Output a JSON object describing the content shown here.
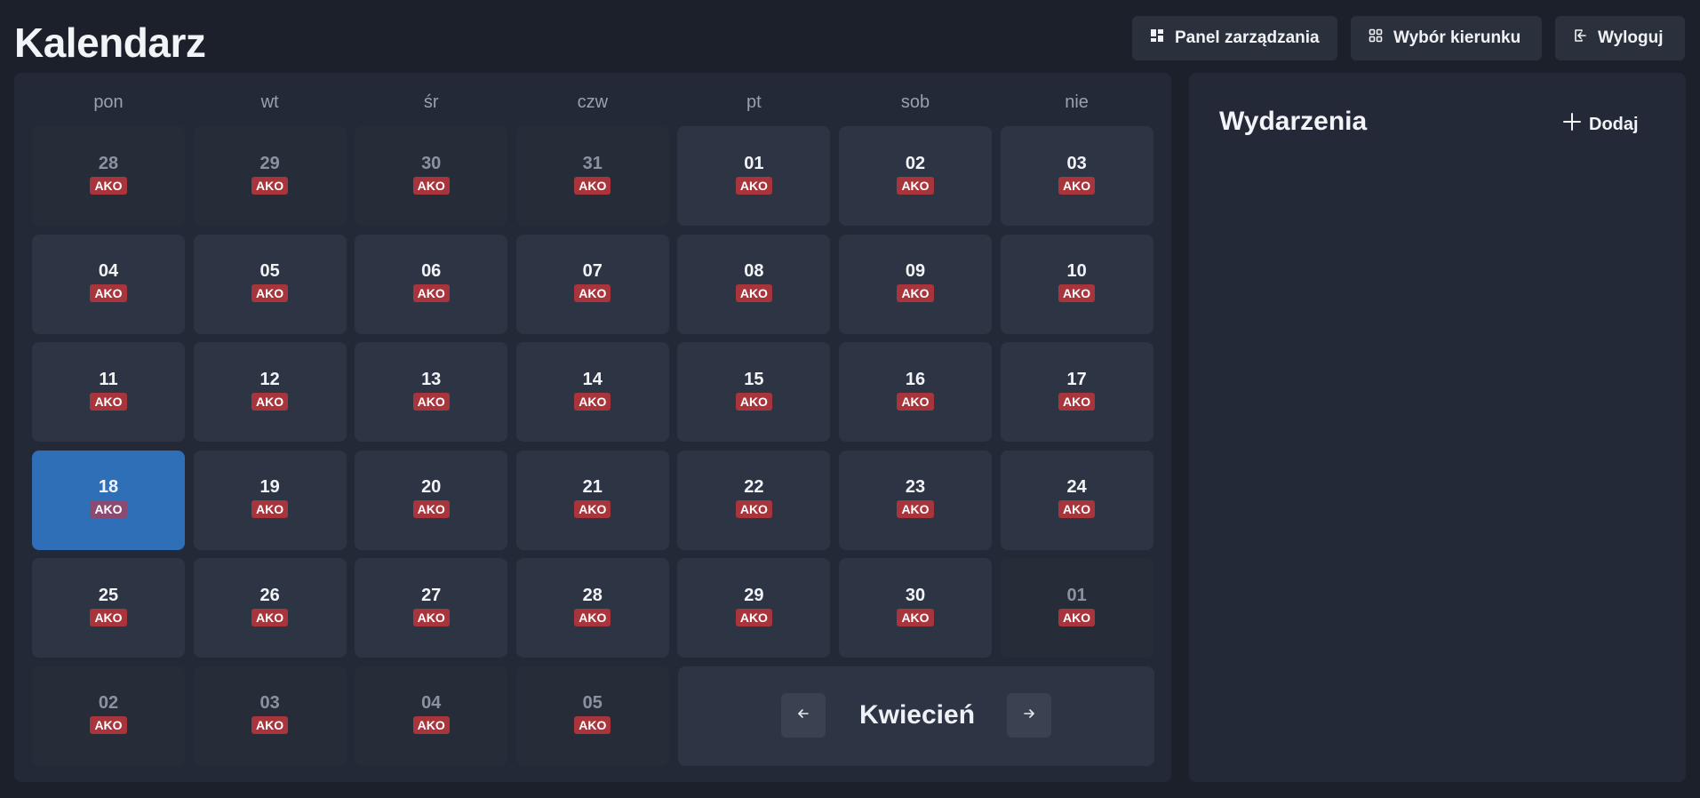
{
  "header": {
    "title": "Kalendarz",
    "buttons": {
      "panel": {
        "label": "Panel zarządzania",
        "icon": "dashboard-icon"
      },
      "kierunek": {
        "label": "Wybór kierunku",
        "icon": "grid-icon"
      },
      "logout": {
        "label": "Wyloguj",
        "icon": "logout-icon"
      }
    }
  },
  "calendar": {
    "weekdays": [
      "pon",
      "wt",
      "śr",
      "czw",
      "pt",
      "sob",
      "nie"
    ],
    "days": [
      {
        "num": "28",
        "badge": "AKO",
        "other": true
      },
      {
        "num": "29",
        "badge": "AKO",
        "other": true
      },
      {
        "num": "30",
        "badge": "AKO",
        "other": true
      },
      {
        "num": "31",
        "badge": "AKO",
        "other": true
      },
      {
        "num": "01",
        "badge": "AKO"
      },
      {
        "num": "02",
        "badge": "AKO"
      },
      {
        "num": "03",
        "badge": "AKO"
      },
      {
        "num": "04",
        "badge": "AKO"
      },
      {
        "num": "05",
        "badge": "AKO"
      },
      {
        "num": "06",
        "badge": "AKO"
      },
      {
        "num": "07",
        "badge": "AKO"
      },
      {
        "num": "08",
        "badge": "AKO"
      },
      {
        "num": "09",
        "badge": "AKO"
      },
      {
        "num": "10",
        "badge": "AKO"
      },
      {
        "num": "11",
        "badge": "AKO"
      },
      {
        "num": "12",
        "badge": "AKO"
      },
      {
        "num": "13",
        "badge": "AKO"
      },
      {
        "num": "14",
        "badge": "AKO"
      },
      {
        "num": "15",
        "badge": "AKO"
      },
      {
        "num": "16",
        "badge": "AKO"
      },
      {
        "num": "17",
        "badge": "AKO"
      },
      {
        "num": "18",
        "badge": "AKO",
        "selected": true
      },
      {
        "num": "19",
        "badge": "AKO"
      },
      {
        "num": "20",
        "badge": "AKO"
      },
      {
        "num": "21",
        "badge": "AKO"
      },
      {
        "num": "22",
        "badge": "AKO"
      },
      {
        "num": "23",
        "badge": "AKO"
      },
      {
        "num": "24",
        "badge": "AKO"
      },
      {
        "num": "25",
        "badge": "AKO"
      },
      {
        "num": "26",
        "badge": "AKO"
      },
      {
        "num": "27",
        "badge": "AKO"
      },
      {
        "num": "28",
        "badge": "AKO"
      },
      {
        "num": "29",
        "badge": "AKO"
      },
      {
        "num": "30",
        "badge": "AKO"
      },
      {
        "num": "01",
        "badge": "AKO",
        "other": true
      },
      {
        "num": "02",
        "badge": "AKO",
        "other": true
      },
      {
        "num": "03",
        "badge": "AKO",
        "other": true
      },
      {
        "num": "04",
        "badge": "AKO",
        "other": true
      },
      {
        "num": "05",
        "badge": "AKO",
        "other": true
      }
    ],
    "month_nav": {
      "month": "Kwiecień",
      "prev_icon": "arrow-left-icon",
      "next_icon": "arrow-right-icon"
    }
  },
  "events": {
    "title": "Wydarzenia",
    "add_label": "Dodaj",
    "add_icon": "plus-icon"
  },
  "colors": {
    "background": "#1b202b",
    "panel": "#232936",
    "day_cell": "#2d3444",
    "selected": "#2e6fb7",
    "badge": "#a8343c"
  }
}
